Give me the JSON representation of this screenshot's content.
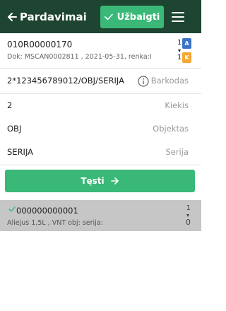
{
  "header": {
    "title": "Pardavimai",
    "back_icon": "arrow-left-icon",
    "finish_label": "Užbaigti",
    "finish_icon": "check-icon",
    "menu_icon": "hamburger-menu-icon",
    "background_color": "#1e4532",
    "accent_color": "#3ab878"
  },
  "document": {
    "code": "010R00000170",
    "info": "Dok: MSCAN0002811 , 2021-05-31, renka:I",
    "count_top": "1",
    "count_bottom": "1",
    "badge_a": "A",
    "badge_k": "K",
    "badge_a_color": "#3a73c8",
    "badge_k_color": "#f4a831"
  },
  "fields": {
    "barcode": {
      "value": "2*123456789012/OBJ/SERIJA",
      "label": "Barkodas",
      "icon": "info-icon"
    },
    "quantity": {
      "value": "2",
      "label": "Kiekis"
    },
    "object": {
      "value": "OBJ",
      "label": "Objektas"
    },
    "series": {
      "value": "SERIJA",
      "label": "Serija"
    }
  },
  "continue_button": {
    "label": "Tęsti",
    "icon": "arrow-right-icon"
  },
  "items": [
    {
      "code": "000000000001",
      "description": "Aliejus 1,5L , VNT obj: serija:",
      "count_top": "1",
      "count_bottom": "0",
      "status_icon": "check-icon"
    }
  ]
}
